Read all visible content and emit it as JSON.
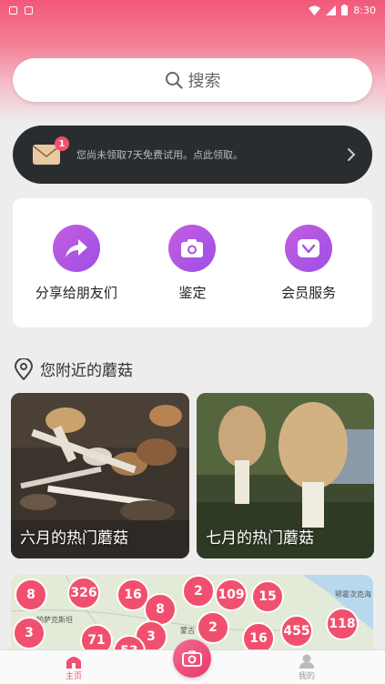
{
  "status_bar": {
    "time": "8:30"
  },
  "search": {
    "label": "搜索"
  },
  "banner": {
    "badge_count": "1",
    "message": "您尚未领取7天免费试用。点此领取。"
  },
  "actions": [
    {
      "label": "分享给朋友们",
      "icon": "share-arrow-icon"
    },
    {
      "label": "鉴定",
      "icon": "camera-icon"
    },
    {
      "label": "会员服务",
      "icon": "vip-diamond-icon"
    }
  ],
  "nearby": {
    "title": "您附近的蘑菇"
  },
  "tiles": [
    {
      "caption": "六月的热门蘑菇"
    },
    {
      "caption": "七月的热门蘑菇"
    }
  ],
  "map": {
    "pins": [
      "8",
      "326",
      "16",
      "8",
      "2",
      "109",
      "15",
      "3",
      "71",
      "3",
      "2",
      "16",
      "455",
      "118",
      "53"
    ],
    "labels": [
      "帕萨克斯坦",
      "蒙古",
      "鄂霍次克海"
    ]
  },
  "tabs": {
    "home": "主页",
    "mine": "我的"
  },
  "colors": {
    "accent": "#f0506e",
    "purple": "#a451e4",
    "banner_bg": "#2a2d30"
  }
}
